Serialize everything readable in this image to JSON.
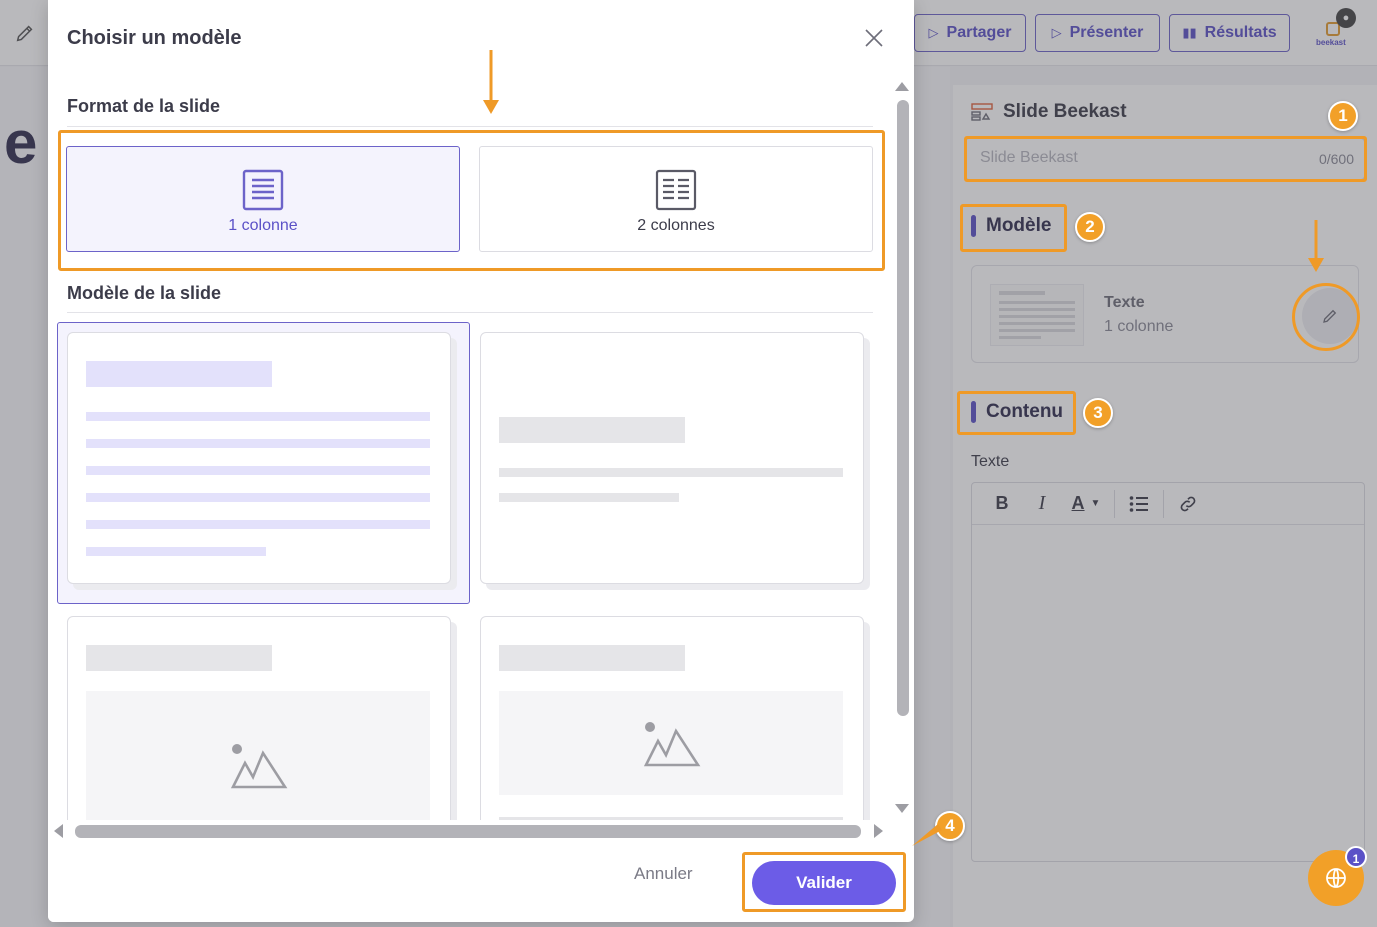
{
  "topbar": {
    "share_label": "Partager",
    "present_label": "Présenter",
    "results_label": "Résultats",
    "logo_text": "beekast"
  },
  "background": {
    "slide_letter": "e"
  },
  "panel": {
    "title": "Slide Beekast",
    "title_field": {
      "placeholder": "Slide Beekast",
      "value": "",
      "counter": "0/600"
    },
    "model_section_label": "Modèle",
    "current_model": {
      "name": "Texte",
      "layout": "1 colonne"
    },
    "content_section_label": "Contenu",
    "text_label": "Texte",
    "toolbar": {
      "bold": "B",
      "italic": "I",
      "text_color": "A"
    }
  },
  "help": {
    "badge_count": "1"
  },
  "modal": {
    "title": "Choisir un modèle",
    "format_group_label": "Format de la slide",
    "formats": [
      {
        "label": "1 colonne",
        "selected": true
      },
      {
        "label": "2 colonnes",
        "selected": false
      }
    ],
    "template_group_label": "Modèle de la slide",
    "cancel_label": "Annuler",
    "validate_label": "Valider"
  },
  "annotations": {
    "steps": [
      "1",
      "2",
      "3",
      "4"
    ],
    "accent_color": "#ef9a27"
  },
  "colors": {
    "primary": "#6c5ce7",
    "accent": "#f2a028"
  }
}
